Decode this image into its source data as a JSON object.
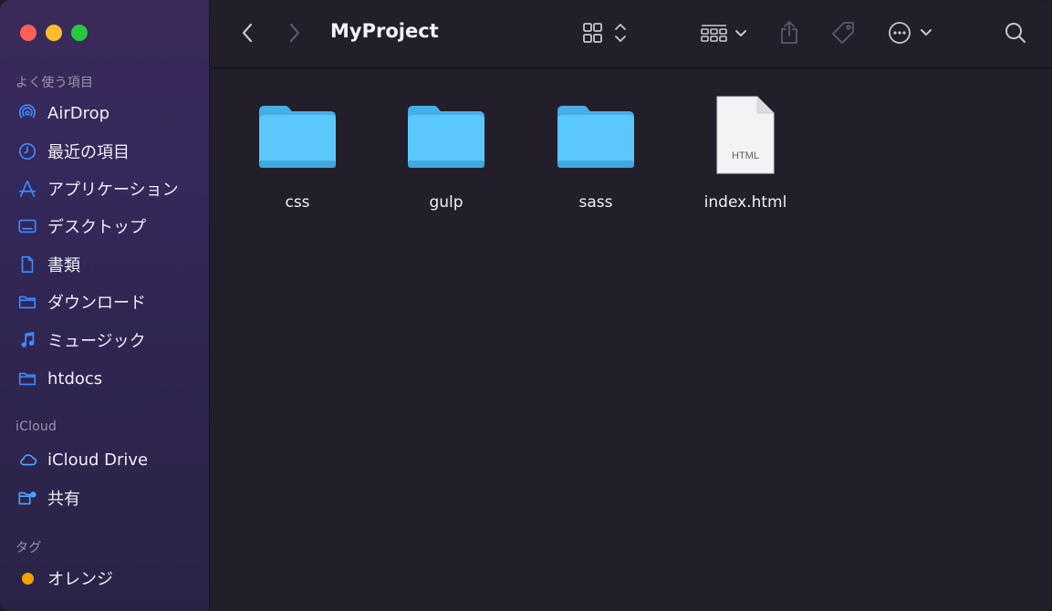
{
  "window": {
    "title": "MyProject"
  },
  "sidebar": {
    "sections": [
      {
        "heading": "よく使う項目"
      },
      {
        "heading": "iCloud"
      },
      {
        "heading": "タグ"
      }
    ],
    "favorites": [
      {
        "label": "AirDrop",
        "icon": "airdrop-icon"
      },
      {
        "label": "最近の項目",
        "icon": "clock-icon"
      },
      {
        "label": "アプリケーション",
        "icon": "applications-icon"
      },
      {
        "label": "デスクトップ",
        "icon": "desktop-icon"
      },
      {
        "label": "書類",
        "icon": "document-icon"
      },
      {
        "label": "ダウンロード",
        "icon": "folder-icon"
      },
      {
        "label": "ミュージック",
        "icon": "music-icon"
      },
      {
        "label": "htdocs",
        "icon": "folder-icon"
      }
    ],
    "icloud": [
      {
        "label": "iCloud Drive",
        "icon": "cloud-icon"
      },
      {
        "label": "共有",
        "icon": "shared-folder-icon"
      }
    ],
    "tags": [
      {
        "label": "オレンジ",
        "color": "#f6a300"
      }
    ]
  },
  "toolbar": {
    "back": "chevron-left-icon",
    "forward": "chevron-right-icon",
    "view": "grid-view-icon",
    "group": "group-icon",
    "share": "share-icon",
    "tag": "tag-icon",
    "more": "ellipsis-circle-icon",
    "search": "search-icon"
  },
  "files": [
    {
      "name": "css",
      "kind": "folder"
    },
    {
      "name": "gulp",
      "kind": "folder"
    },
    {
      "name": "sass",
      "kind": "folder"
    },
    {
      "name": "index.html",
      "kind": "html",
      "badge": "HTML"
    }
  ],
  "colors": {
    "accent": "#3b8bff",
    "folder": "#5ac8fa"
  }
}
